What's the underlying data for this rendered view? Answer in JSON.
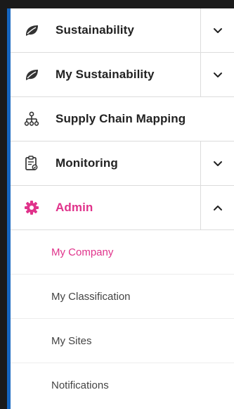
{
  "colors": {
    "accent": "#1565c0",
    "active": "#e0338b",
    "text": "#222222",
    "subtext": "#444444"
  },
  "menu": {
    "items": [
      {
        "label": "Sustainability",
        "icon": "leaf-icon",
        "chevron": "chevron-down-icon"
      },
      {
        "label": "My Sustainability",
        "icon": "leaf-icon",
        "chevron": "chevron-down-icon"
      },
      {
        "label": "Supply Chain Mapping",
        "icon": "org-chart-icon"
      },
      {
        "label": "Monitoring",
        "icon": "clipboard-icon",
        "chevron": "chevron-down-icon"
      },
      {
        "label": "Admin",
        "icon": "gear-icon",
        "chevron": "chevron-up-icon",
        "active": true
      }
    ],
    "admin_subitems": [
      {
        "label": "My Company",
        "active": true
      },
      {
        "label": "My Classification"
      },
      {
        "label": "My Sites"
      },
      {
        "label": "Notifications"
      }
    ]
  }
}
